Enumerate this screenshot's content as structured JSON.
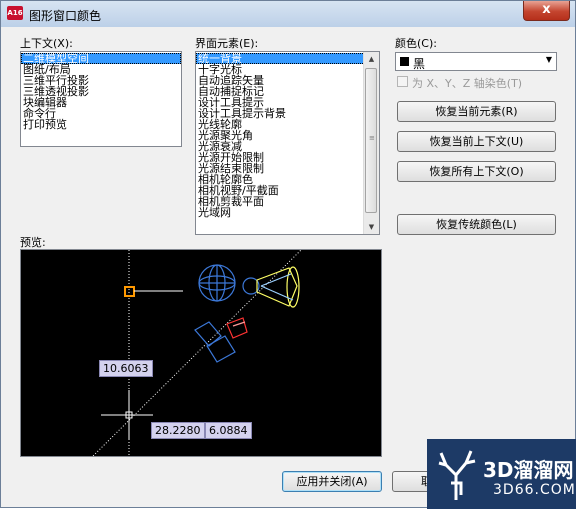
{
  "window": {
    "title": "图形窗口颜色",
    "app_icon_text": "A16",
    "close_glyph": "x"
  },
  "context": {
    "label": "上下文(X):",
    "items": [
      "二维模型空间",
      "图纸/布局",
      "三维平行投影",
      "三维透视投影",
      "块编辑器",
      "命令行",
      "打印预览"
    ],
    "selected_index": 0
  },
  "elements": {
    "label": "界面元素(E):",
    "items": [
      "统一背景",
      "十字光标",
      "自动追踪矢量",
      "自动捕捉标记",
      "设计工具提示",
      "设计工具提示背景",
      "光线轮廓",
      "光源聚光角",
      "光源衰减",
      "光源开始限制",
      "光源结束限制",
      "相机轮廓色",
      "相机视野/平截面",
      "相机剪裁平面",
      "光域网"
    ],
    "selected_index": 0,
    "scroll_up": "▲",
    "scroll_down": "▼",
    "scroll_grip": "≡"
  },
  "color": {
    "label": "颜色(C):",
    "value": "黑",
    "swatch_color": "#000000",
    "dropdown_glyph": "▼",
    "tint_checkbox_label": "为 X、Y、Z 轴染色(T)",
    "tint_checked": false
  },
  "buttons": {
    "restore_element": "恢复当前元素(R)",
    "restore_context": "恢复当前上下文(U)",
    "restore_all": "恢复所有上下文(O)",
    "restore_classic": "恢复传统颜色(L)",
    "apply_close": "应用并关闭(A)",
    "cancel": "取消"
  },
  "preview": {
    "label": "预览:",
    "dim_vertical": "10.6063",
    "dim_x": "28.2280",
    "dim_y": "6.0884"
  },
  "watermark": {
    "text": "3D溜溜网",
    "sub": "3D66.COM"
  },
  "colors": {
    "accent": "#3399ff",
    "preview_bg": "#000000",
    "crosshair": "#ffffff",
    "marker": "#ff9900",
    "light_blue": "#3c78d8",
    "light_yellow": "#ffff66",
    "camera_red": "#ff3333"
  }
}
